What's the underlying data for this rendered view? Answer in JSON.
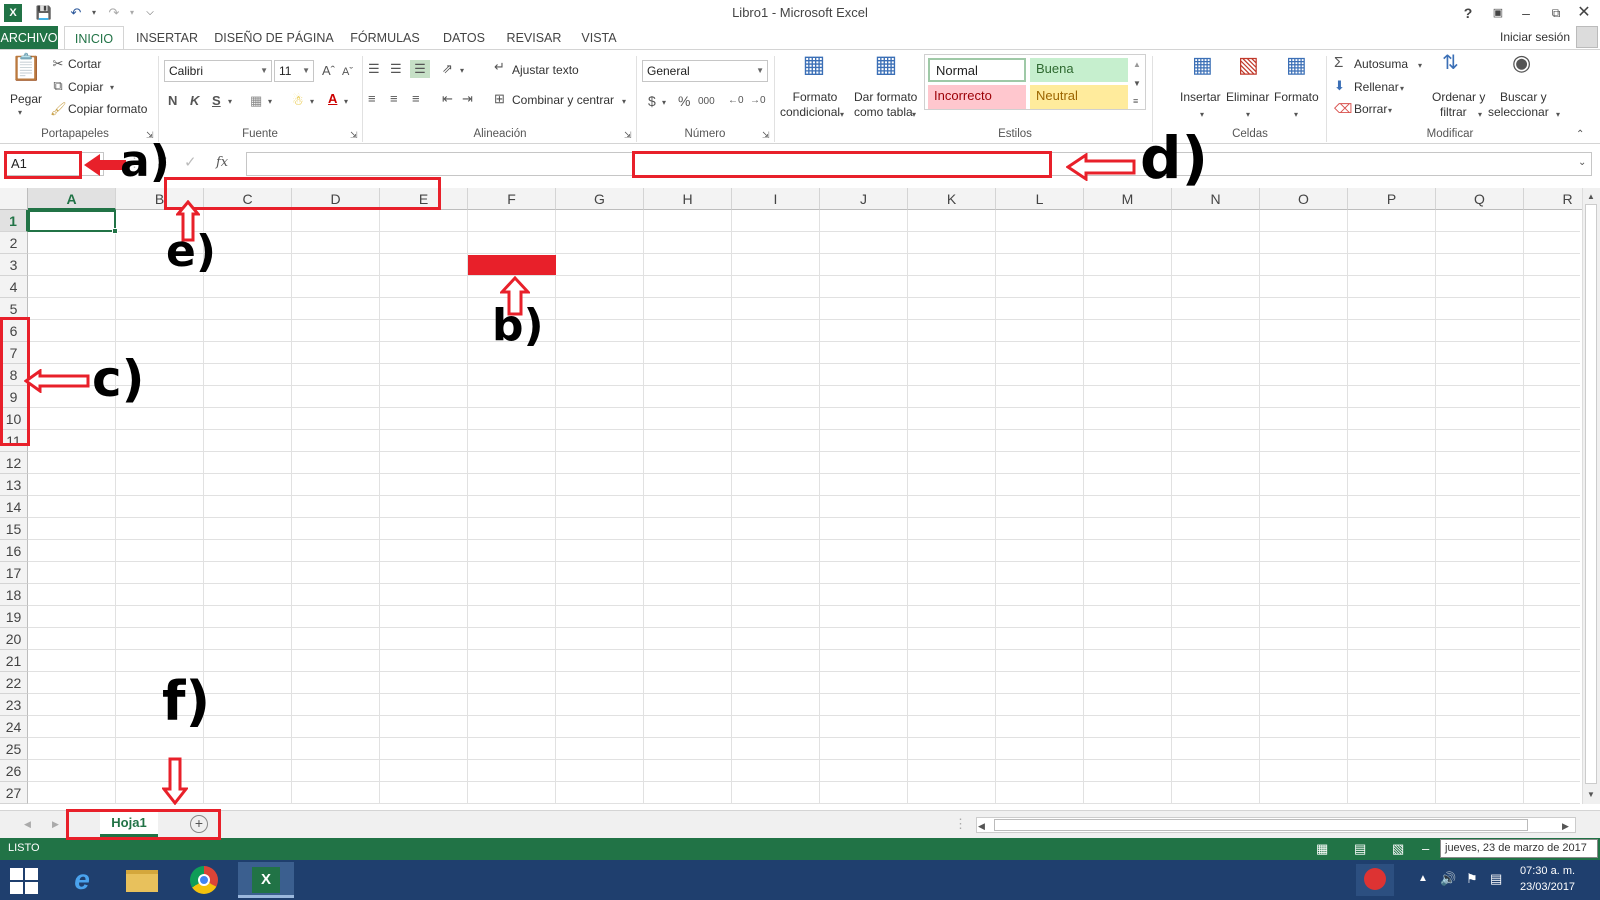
{
  "window": {
    "title": "Libro1 - Microsoft Excel",
    "help": "?",
    "account": "Iniciar sesión"
  },
  "tabs": {
    "file": "ARCHIVO",
    "home": "INICIO",
    "insert": "INSERTAR",
    "layout": "DISEÑO DE PÁGINA",
    "formulas": "FÓRMULAS",
    "data": "DATOS",
    "review": "REVISAR",
    "view": "VISTA"
  },
  "clipboard": {
    "paste": "Pegar",
    "cut": "Cortar",
    "copy": "Copiar",
    "format_painter": "Copiar formato",
    "label": "Portapapeles"
  },
  "font": {
    "name": "Calibri",
    "size": "11",
    "bold": "N",
    "italic": "K",
    "underline": "S",
    "label": "Fuente"
  },
  "alignment": {
    "wrap": "Ajustar texto",
    "merge": "Combinar y centrar",
    "label": "Alineación"
  },
  "number": {
    "format": "General",
    "currency": "$",
    "percent": "%",
    "thousands": "000",
    "label": "Número"
  },
  "styles": {
    "cond_1": "Formato",
    "cond_2": "condicional",
    "table_1": "Dar formato",
    "table_2": "como tabla",
    "normal": "Normal",
    "good": "Buena",
    "bad": "Incorrecto",
    "neutral": "Neutral",
    "label": "Estilos"
  },
  "cells": {
    "insert": "Insertar",
    "delete": "Eliminar",
    "format": "Formato",
    "label": "Celdas"
  },
  "editing": {
    "autosum": "Autosuma",
    "fill": "Rellenar",
    "clear": "Borrar",
    "sort_1": "Ordenar y",
    "sort_2": "filtrar",
    "find_1": "Buscar y",
    "find_2": "seleccionar",
    "label": "Modificar"
  },
  "formula_bar": {
    "name_box": "A1",
    "fx": "fx"
  },
  "columns": [
    "A",
    "B",
    "C",
    "D",
    "E",
    "F",
    "G",
    "H",
    "I",
    "J",
    "K",
    "L",
    "M",
    "N",
    "O",
    "P",
    "Q",
    "R"
  ],
  "rows": [
    "1",
    "2",
    "3",
    "4",
    "5",
    "6",
    "7",
    "8",
    "9",
    "10",
    "11",
    "12",
    "13",
    "14",
    "15",
    "16",
    "17",
    "18",
    "19",
    "20",
    "21",
    "22",
    "23",
    "24",
    "25",
    "26",
    "27"
  ],
  "sheet": {
    "tab": "Hoja1"
  },
  "status": {
    "mode": "LISTO",
    "tooltip": "jueves, 23 de marzo de 2017"
  },
  "taskbar": {
    "time": "07:30 a. m.",
    "date": "23/03/2017"
  },
  "annotations": {
    "a": "a)",
    "b": "b)",
    "c": "c)",
    "d": "d)",
    "e": "e)",
    "f": "f)"
  },
  "colors": {
    "excel_green": "#217346",
    "annotation_red": "#e8202a",
    "taskbar": "#1f3f6e"
  }
}
